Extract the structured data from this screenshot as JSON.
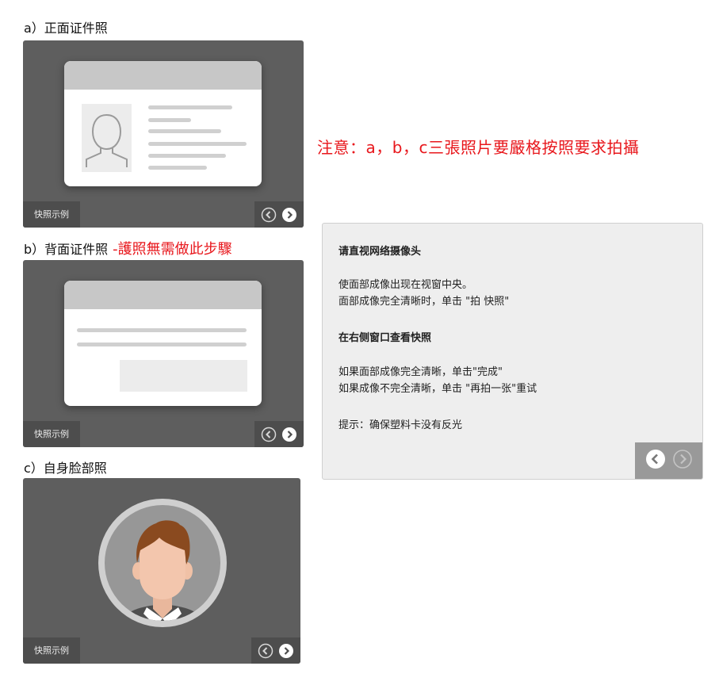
{
  "sections": {
    "a_label": "a）正面证件照",
    "b_label": "b）背面证件照",
    "b_note": "-護照無需做此步驟",
    "c_label": "c）自身脸部照"
  },
  "snapshot_example_label": "快照示例",
  "notice": "注意：a，b，c三張照片要嚴格按照要求拍攝",
  "instructions": {
    "heading1": "请直视网络摄像头",
    "line1": "使面部成像出现在视窗中央。",
    "line2": "面部成像完全清晰时，单击 \"拍 快照\"",
    "heading2": "在右侧窗口查看快照",
    "line3": "如果面部成像完全清晰，单击\"完成\"",
    "line4": "如果成像不完全清晰，单击 \"再拍一张\"重试",
    "tip": "提示：确保塑料卡没有反光"
  },
  "colors": {
    "panel_bg": "#5e5e5e",
    "notice_red": "#e8171c",
    "instructions_bg": "#eeeeee"
  },
  "icons": [
    "prev-arrow-icon",
    "next-arrow-icon",
    "id-portrait-icon",
    "face-avatar-icon"
  ]
}
